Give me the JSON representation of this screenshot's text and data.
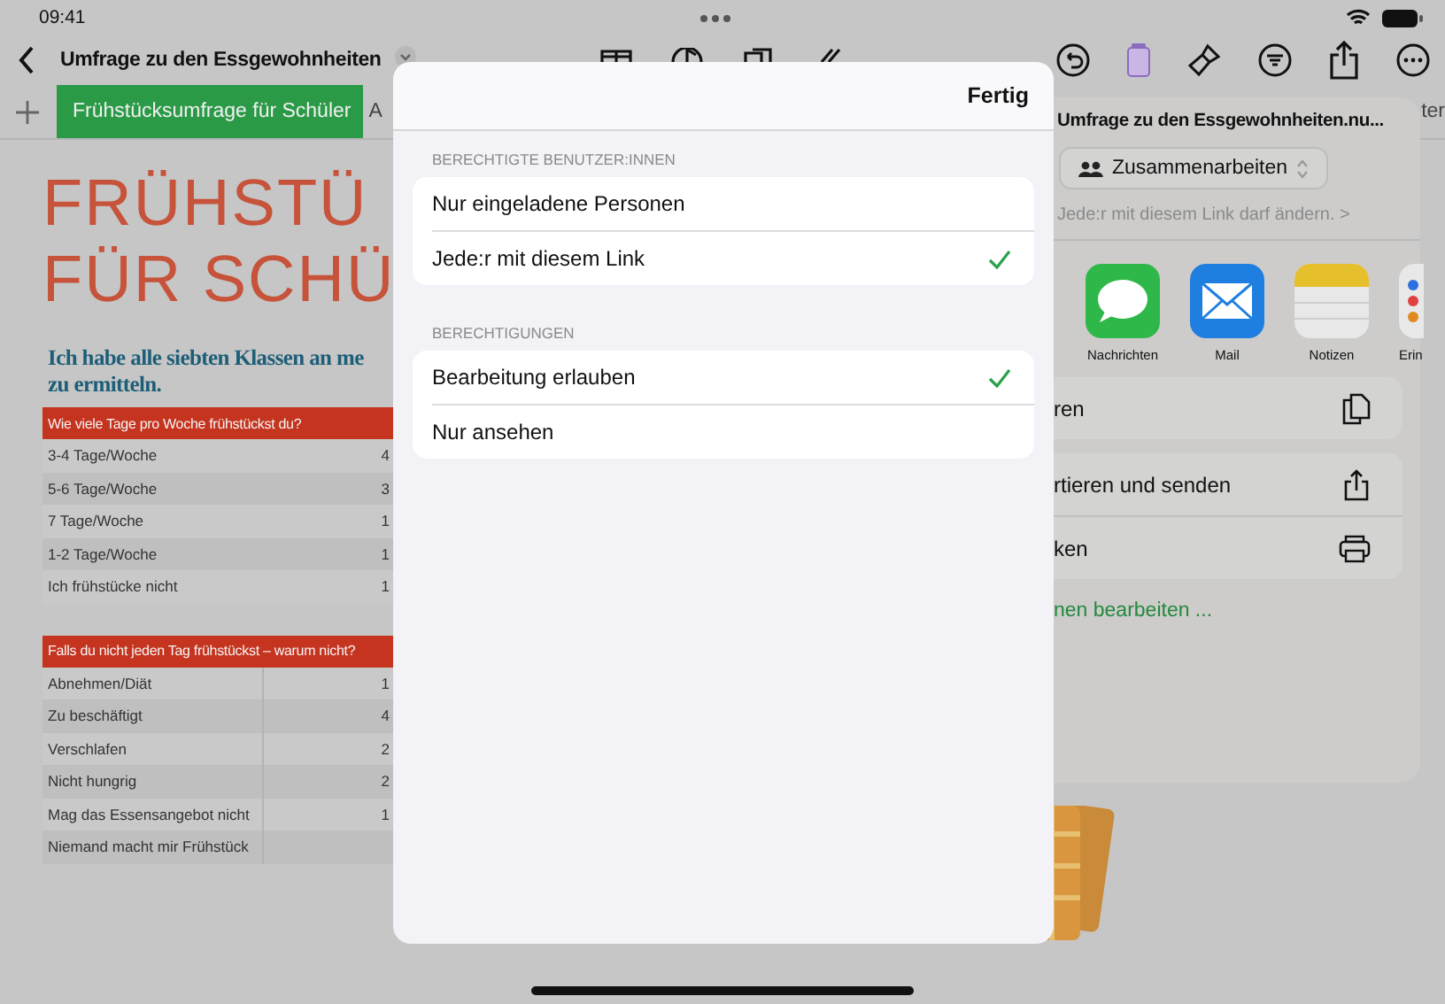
{
  "status_bar": {
    "time": "09:41"
  },
  "toolbar": {
    "title": "Umfrage zu den Essgewohnheiten"
  },
  "tabs": [
    {
      "label": "Frühstücksumfrage für Schüler",
      "selected": true
    },
    {
      "label": "A",
      "selected": false
    },
    {
      "label": "ter",
      "selected": false
    }
  ],
  "document": {
    "title_lines": [
      "FRÜHSTÜ",
      "FÜR SCHÜ"
    ],
    "intro_lines": [
      "Ich habe alle siebten Klassen an me",
      "zu ermitteln."
    ],
    "tables": [
      {
        "header": "Wie viele Tage pro Woche frühstückst du?",
        "divided": false,
        "rows": [
          {
            "label": "3-4 Tage/Woche",
            "value": "4"
          },
          {
            "label": "5-6 Tage/Woche",
            "value": "3"
          },
          {
            "label": "7 Tage/Woche",
            "value": "1"
          },
          {
            "label": "1-2 Tage/Woche",
            "value": "1"
          },
          {
            "label": "Ich frühstücke nicht",
            "value": "1"
          }
        ]
      },
      {
        "header": "Falls du nicht jeden Tag frühstückst – warum nicht?",
        "divided": true,
        "rows": [
          {
            "label": "Abnehmen/Diät",
            "value": "1"
          },
          {
            "label": "Zu beschäftigt",
            "value": "4"
          },
          {
            "label": "Verschlafen",
            "value": "2"
          },
          {
            "label": "Nicht hungrig",
            "value": "2"
          },
          {
            "label": "Mag das Essensangebot nicht",
            "value": "1"
          },
          {
            "label": "Niemand macht mir Frühstück",
            "value": ""
          }
        ]
      }
    ]
  },
  "share_popover": {
    "title": "Umfrage zu den Essgewohnheiten.nu...",
    "mode_button": "Zusammenarbeiten",
    "access_note": "Jede:r mit diesem Link darf ändern.",
    "access_chevron": ">",
    "apps": [
      {
        "label": "Nachrichten",
        "kind": "messages"
      },
      {
        "label": "Mail",
        "kind": "mail"
      },
      {
        "label": "Notizen",
        "kind": "notes"
      },
      {
        "label": "Erin",
        "kind": "reminders"
      }
    ],
    "action_groups": [
      [
        {
          "label": "ren",
          "kind": "copy"
        }
      ],
      [
        {
          "label": "rtieren und senden",
          "kind": "export"
        },
        {
          "label": "ken",
          "kind": "print"
        }
      ]
    ],
    "edit_link": "nen bearbeiten ..."
  },
  "settings_sheet": {
    "done_button": "Fertig",
    "sections": [
      {
        "heading": "BERECHTIGTE BENUTZER:INNEN",
        "options": [
          {
            "label": "Nur eingeladene Personen",
            "selected": false
          },
          {
            "label": "Jede:r mit diesem Link",
            "selected": true
          }
        ]
      },
      {
        "heading": "BERECHTIGUNGEN",
        "options": [
          {
            "label": "Bearbeitung erlauben",
            "selected": true
          },
          {
            "label": "Nur ansehen",
            "selected": false
          }
        ]
      }
    ]
  }
}
